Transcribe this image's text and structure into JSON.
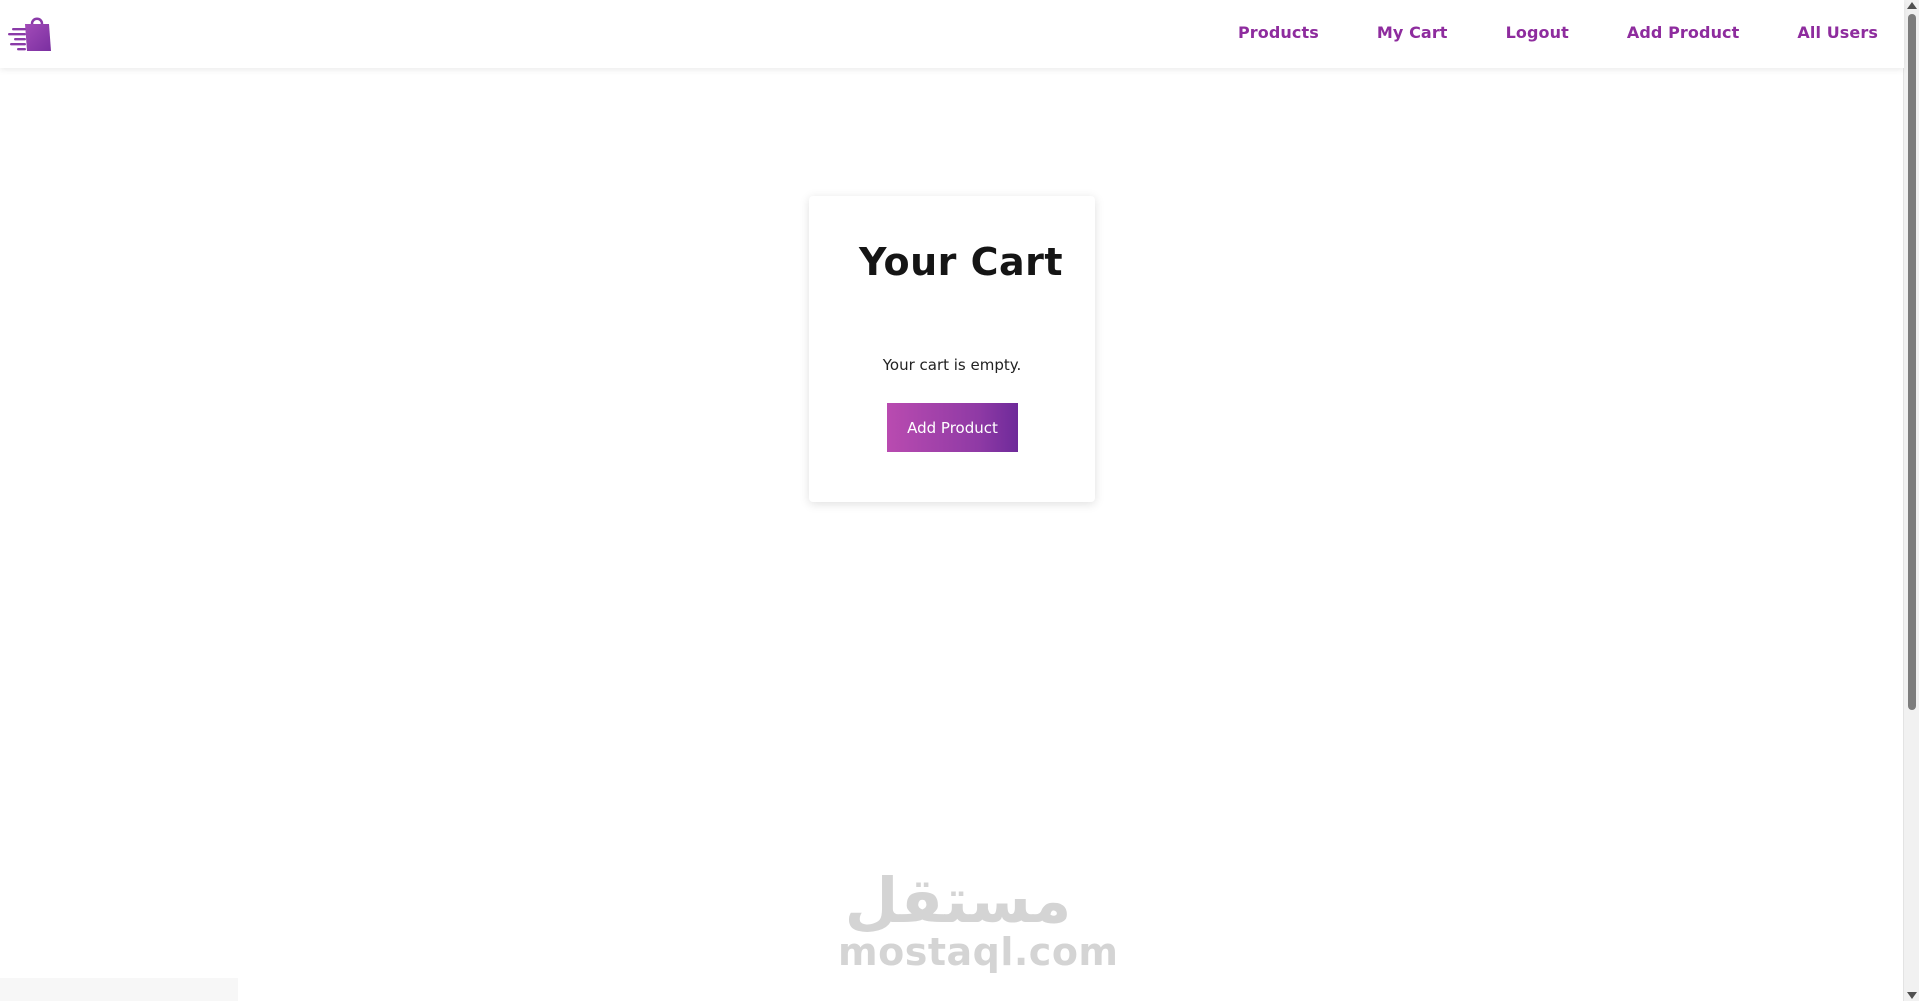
{
  "navbar": {
    "logo_icon": "shopping-bag-logo-icon",
    "links": [
      {
        "label": "Products"
      },
      {
        "label": "My Cart"
      },
      {
        "label": "Logout"
      },
      {
        "label": "Add Product"
      },
      {
        "label": "All Users"
      }
    ]
  },
  "cart": {
    "title": "Your Cart",
    "empty_message": "Your cart is empty.",
    "add_button_label": "Add Product"
  },
  "watermark": {
    "arabic": "مستقل",
    "latin": "mostaql.com"
  },
  "colors": {
    "accent": "#8e2c9e",
    "button_gradient_start": "#b94bb0",
    "button_gradient_end": "#6e2a9a"
  }
}
